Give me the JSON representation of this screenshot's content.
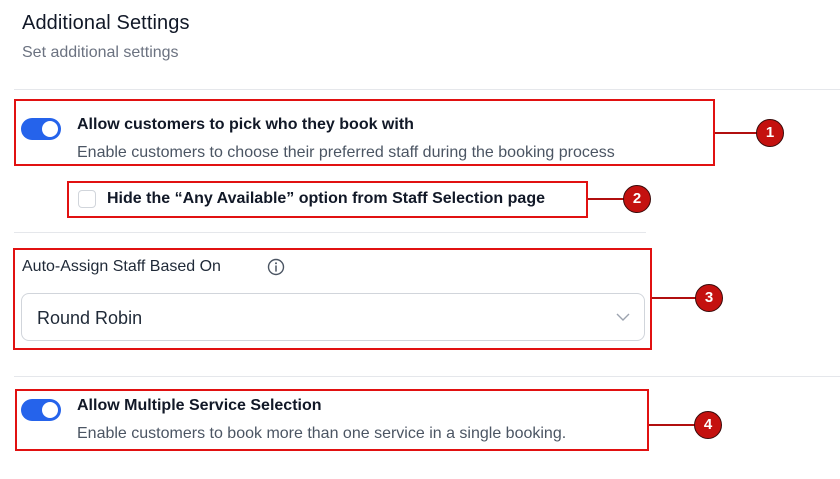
{
  "header": {
    "title": "Additional Settings",
    "subtitle": "Set additional settings"
  },
  "settings": {
    "pick_staff": {
      "label": "Allow customers to pick who they book with",
      "description": "Enable customers to choose their preferred staff during the booking process",
      "enabled": true
    },
    "hide_any_available": {
      "label": "Hide the “Any Available” option from Staff Selection page",
      "checked": false
    },
    "auto_assign": {
      "label": "Auto-Assign Staff Based On",
      "info_icon": "info-icon",
      "selected": "Round Robin"
    },
    "multiple_service": {
      "label": "Allow Multiple Service Selection",
      "description": "Enable customers to book more than one service in a single booking.",
      "enabled": true
    }
  },
  "annotations": {
    "badges": [
      "1",
      "2",
      "3",
      "4"
    ]
  },
  "colors": {
    "toggle_on": "#2563eb",
    "annotation_red": "#e11111",
    "badge_red": "#c4110f"
  }
}
